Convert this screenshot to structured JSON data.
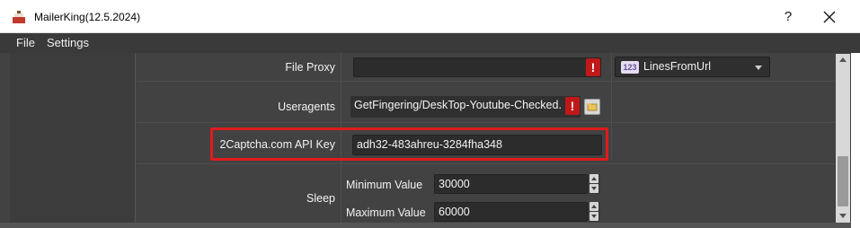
{
  "window": {
    "title": "MailerKing(12.5.2024)",
    "help_label": "?",
    "close_label": "✕"
  },
  "menu": {
    "items": [
      "File",
      "Settings"
    ]
  },
  "settings": {
    "file_proxy": {
      "label": "File Proxy",
      "value": "",
      "warning": "!",
      "dropdown": {
        "icon_text": "123",
        "selected": "LinesFromUrl"
      }
    },
    "useragents": {
      "label": "Useragents",
      "value": "GetFingering/DeskTop-Youtube-Checked.",
      "warning": "!"
    },
    "captcha": {
      "label": "2Captcha.com API Key",
      "value": "adh32-483ahreu-3284fha348"
    },
    "sleep": {
      "label": "Sleep",
      "min_label": "Minimum Value",
      "min_value": "30000",
      "max_label": "Maximum Value",
      "max_value": "60000"
    }
  },
  "colors": {
    "highlight": "#e01b1b",
    "warning": "#c01818",
    "background": "#424242"
  }
}
